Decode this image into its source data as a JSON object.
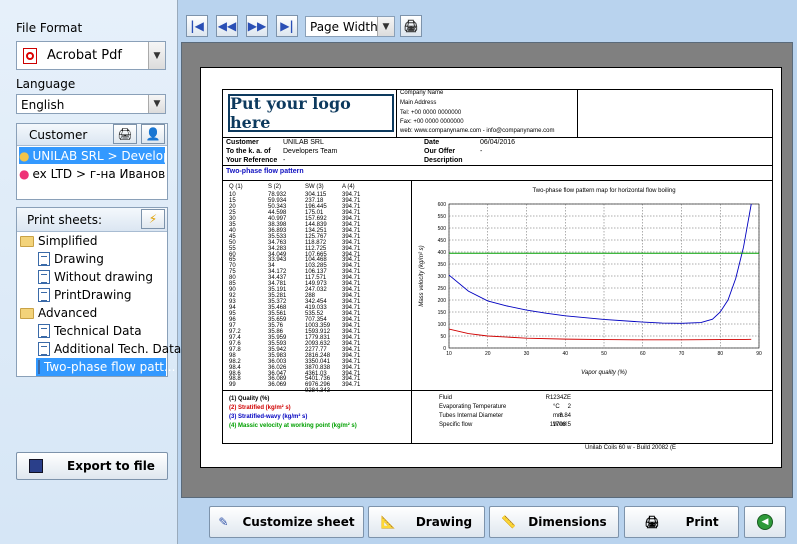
{
  "left": {
    "file_format_label": "File Format",
    "file_format_value": "Acrobat Pdf",
    "language_label": "Language",
    "language_value": "English",
    "customer_label": "Customer",
    "customers": [
      "UNILAB SRL > Develope...",
      "ex LTD > г-на Иванова"
    ],
    "print_sheets_label": "Print sheets:",
    "tree": {
      "simplified": "Simplified",
      "drawing": "Drawing",
      "without_drawing": "Without drawing",
      "print_drawing": "PrintDrawing",
      "advanced": "Advanced",
      "technical_data": "Technical Data",
      "additional_tech": "Additional Tech. Data",
      "two_phase": "Two-phase flow patt..."
    },
    "export_label": "Export to file"
  },
  "toolbar": {
    "zoom_value": "Page Width"
  },
  "sheet": {
    "logo_text": "Put your logo here",
    "company": [
      "Company Name",
      "Main Address",
      "Tel: +00 0000 0000000",
      "Fax: +00 0000 0000000",
      "web: www.companyname.com  -  info@companyname.com"
    ],
    "customer_label": "Customer",
    "customer_value": "UNILAB SRL",
    "to_label": "To the k. a. of",
    "to_value": "Developers Team",
    "ref_label": "Your Reference",
    "ref_value": "-",
    "date_label": "Date",
    "date_value": "06/04/2016",
    "offer_label": "Our Offer",
    "offer_value": "-",
    "desc_label": "Description",
    "section_title": "Two-phase flow pattern",
    "table_headers": [
      "Q (1)",
      "S (2)",
      "SW (3)",
      "A (4)"
    ],
    "q": [
      "10",
      "15",
      "20",
      "25",
      "30",
      "35",
      "40",
      "45",
      "50",
      "55",
      "60",
      "65",
      "70",
      "75",
      "80",
      "85",
      "90",
      "92",
      "93",
      "94",
      "95",
      "96",
      "97",
      "97.2",
      "97.4",
      "97.6",
      "97.8",
      "98",
      "98.2",
      "98.4",
      "98.6",
      "98.8",
      "99"
    ],
    "s": [
      "78.932",
      "59.934",
      "50.343",
      "44.598",
      "40.997",
      "38.398",
      "36.893",
      "35.533",
      "34.763",
      "34.283",
      "34.049",
      "33.943",
      "34",
      "34.172",
      "34.437",
      "34.781",
      "35.191",
      "35.281",
      "35.372",
      "35.468",
      "35.561",
      "35.659",
      "35.76",
      "35.86",
      "35.959",
      "35.593",
      "35.942",
      "35.983",
      "36.003",
      "36.026",
      "36.047",
      "36.089",
      "36.069"
    ],
    "sw": [
      "304.115",
      "237.18",
      "196.445",
      "175.01",
      "157.692",
      "144.839",
      "134.251",
      "125.767",
      "118.872",
      "112.725",
      "107.665",
      "104.468",
      "103.285",
      "106.137",
      "117.571",
      "149.973",
      "247.032",
      "288",
      "342.454",
      "419.033",
      "535.52",
      "707.354",
      "1003.359",
      "1593.912",
      "1779.831",
      "2093.632",
      "2277.77",
      "2816.248",
      "3350.041",
      "3870.838",
      "4361.03",
      "5401.736",
      "6976.296",
      "9284.343"
    ],
    "a": [
      "394.71",
      "394.71",
      "394.71",
      "394.71",
      "394.71",
      "394.71",
      "394.71",
      "394.71",
      "394.71",
      "394.71",
      "394.71",
      "394.71",
      "394.71",
      "394.71",
      "394.71",
      "394.71",
      "394.71",
      "394.71",
      "394.71",
      "394.71",
      "394.71",
      "394.71",
      "394.71",
      "394.71",
      "394.71",
      "394.71",
      "394.71",
      "394.71",
      "394.71",
      "394.71",
      "394.71",
      "394.71",
      "394.71"
    ],
    "legend": [
      "(1) Quality (%)",
      "(2) Stratified (kg/m² s)",
      "(3) Stratified-wavy (kg/m² s)",
      "(4) Massic velocity at working point (kg/m² s)"
    ],
    "props": [
      {
        "label": "Fluid",
        "value": "R1234ZE",
        "unit": ""
      },
      {
        "label": "Evaporating Temperature",
        "value": "2",
        "unit": "°C"
      },
      {
        "label": "Tubes Internal Diameter",
        "value": "8.84",
        "unit": "mm"
      },
      {
        "label": "Specific flow",
        "value": "11708.5",
        "unit": "W/m²"
      }
    ],
    "footer": "Unilab Coils 60 w - Build 20082 (E"
  },
  "chart_data": {
    "type": "line",
    "title": "Two-phase flow pattern map for horizontal flow boiling",
    "xlabel": "Vapor quality (%)",
    "ylabel": "Mass velocity (kg/m² s)",
    "xlim": [
      10,
      90
    ],
    "ylim": [
      0,
      600
    ],
    "xticks": [
      "10",
      "20",
      "30",
      "40",
      "50",
      "60",
      "70",
      "80",
      "90"
    ],
    "yticks": [
      "0",
      "50",
      "100",
      "150",
      "200",
      "250",
      "300",
      "350",
      "400",
      "450",
      "500",
      "550",
      "600"
    ],
    "colors": {
      "stratified": "#d00000",
      "wavy": "#0000c0",
      "working": "#00a000"
    },
    "series": [
      {
        "key": "stratified",
        "x": [
          10,
          15,
          20,
          30,
          40,
          50,
          60,
          70,
          80,
          85,
          88
        ],
        "y": [
          79,
          60,
          50,
          41,
          37,
          35,
          34,
          34,
          35,
          35,
          36
        ]
      },
      {
        "key": "wavy",
        "x": [
          10,
          15,
          20,
          25,
          30,
          35,
          40,
          50,
          60,
          65,
          70,
          75,
          78,
          80,
          82,
          84,
          86,
          88
        ],
        "y": [
          304,
          237,
          196,
          175,
          158,
          145,
          134,
          119,
          108,
          104,
          103,
          106,
          120,
          150,
          200,
          290,
          420,
          600
        ]
      },
      {
        "key": "working",
        "x": [
          10,
          90
        ],
        "y": [
          395,
          395
        ]
      }
    ]
  },
  "bottom": {
    "customize": "Customize sheet",
    "drawing": "Drawing",
    "dimensions": "Dimensions",
    "print": "Print"
  }
}
